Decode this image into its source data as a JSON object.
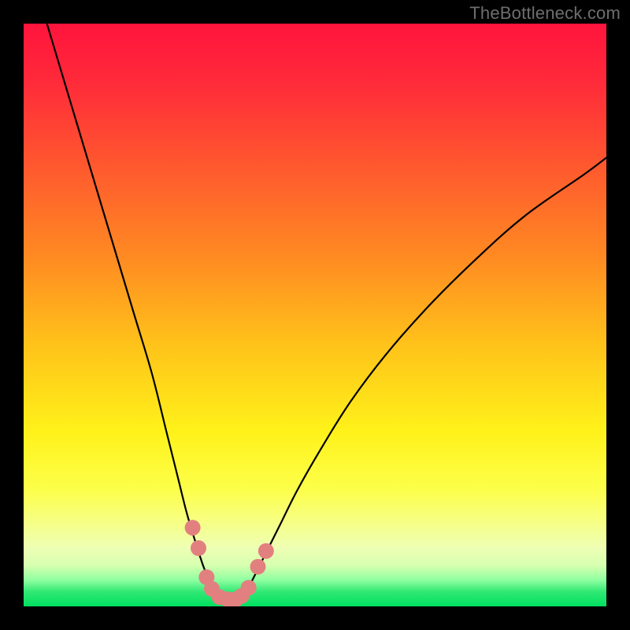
{
  "watermark": "TheBottleneck.com",
  "chart_data": {
    "type": "line",
    "title": "",
    "xlabel": "",
    "ylabel": "",
    "xlim": [
      0,
      100
    ],
    "ylim": [
      0,
      100
    ],
    "gradient_stops": [
      {
        "offset": 0.0,
        "color": "#ff143c"
      },
      {
        "offset": 0.1,
        "color": "#ff2a3a"
      },
      {
        "offset": 0.25,
        "color": "#ff5a2e"
      },
      {
        "offset": 0.4,
        "color": "#ff8a22"
      },
      {
        "offset": 0.55,
        "color": "#ffc21a"
      },
      {
        "offset": 0.7,
        "color": "#fff21a"
      },
      {
        "offset": 0.8,
        "color": "#fcff4a"
      },
      {
        "offset": 0.86,
        "color": "#f6ff8a"
      },
      {
        "offset": 0.9,
        "color": "#eeffb4"
      },
      {
        "offset": 0.93,
        "color": "#d6ffb0"
      },
      {
        "offset": 0.955,
        "color": "#8effa0"
      },
      {
        "offset": 0.975,
        "color": "#30e874"
      },
      {
        "offset": 1.0,
        "color": "#00e060"
      }
    ],
    "series": [
      {
        "name": "left-branch",
        "x": [
          4,
          7,
          10,
          13,
          16,
          19,
          22,
          24.5,
          26.5,
          28,
          29.5,
          30.8,
          32,
          33
        ],
        "y": [
          100,
          90,
          80,
          70,
          60,
          50,
          40,
          30,
          22,
          16,
          11,
          7,
          4,
          2
        ]
      },
      {
        "name": "right-branch",
        "x": [
          38,
          39.5,
          41.5,
          44,
          47,
          51,
          56,
          62,
          69,
          77,
          86,
          96,
          100
        ],
        "y": [
          2,
          5,
          9,
          14,
          20,
          27,
          35,
          43,
          51,
          59,
          67,
          74,
          77
        ]
      },
      {
        "name": "flat-minimum",
        "x": [
          33,
          34,
          35,
          36,
          37,
          38
        ],
        "y": [
          2,
          1.3,
          1,
          1,
          1.3,
          2
        ]
      }
    ],
    "markers": {
      "name": "salmon-dots",
      "color": "#e28080",
      "radius_pct": 1.35,
      "points": [
        {
          "x": 29.0,
          "y": 13.5
        },
        {
          "x": 30.0,
          "y": 10.0
        },
        {
          "x": 31.4,
          "y": 5.0
        },
        {
          "x": 32.3,
          "y": 3.0
        },
        {
          "x": 33.6,
          "y": 1.6
        },
        {
          "x": 35.0,
          "y": 1.2
        },
        {
          "x": 36.4,
          "y": 1.2
        },
        {
          "x": 37.4,
          "y": 1.8
        },
        {
          "x": 38.6,
          "y": 3.2
        },
        {
          "x": 40.2,
          "y": 6.8
        },
        {
          "x": 41.6,
          "y": 9.5
        }
      ]
    }
  }
}
